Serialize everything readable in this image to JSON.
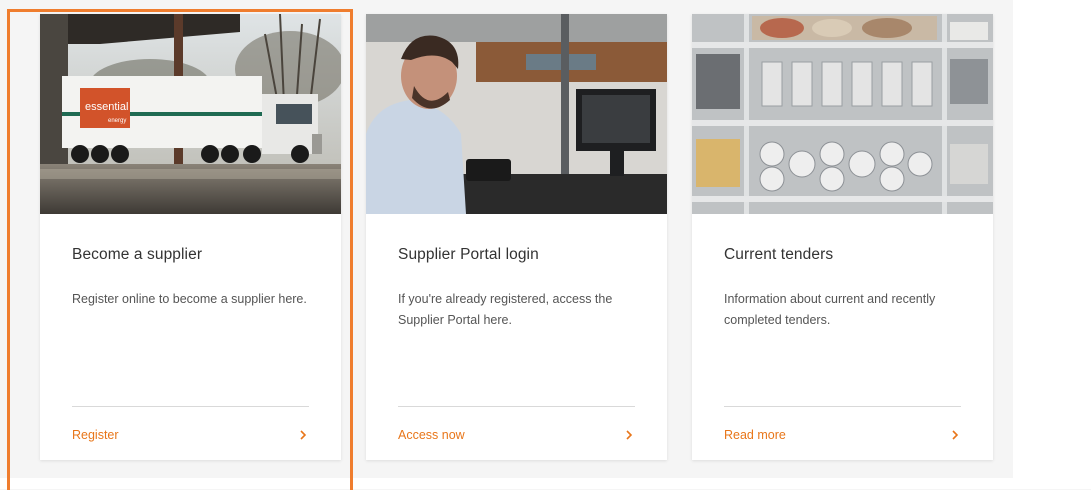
{
  "colors": {
    "accent": "#e8761a",
    "focus_outline": "#ef7d2e",
    "title_text": "#333333",
    "body_text": "#555555"
  },
  "cards": [
    {
      "title": "Become a supplier",
      "description": "Register online to become a supplier here.",
      "link_label": "Register",
      "image": "truck-depot-photo",
      "truck_brand": "essential",
      "truck_brand_sub": "energy"
    },
    {
      "title": "Supplier Portal login",
      "description": "If you're already registered, access the Supplier Portal here.",
      "link_label": "Access now",
      "image": "office-worker-photo"
    },
    {
      "title": "Current tenders",
      "description": "Information about current and recently completed tenders.",
      "link_label": "Read more",
      "image": "warehouse-shelves-photo"
    }
  ],
  "icons": {
    "link_arrow": "chevron-right-icon"
  }
}
